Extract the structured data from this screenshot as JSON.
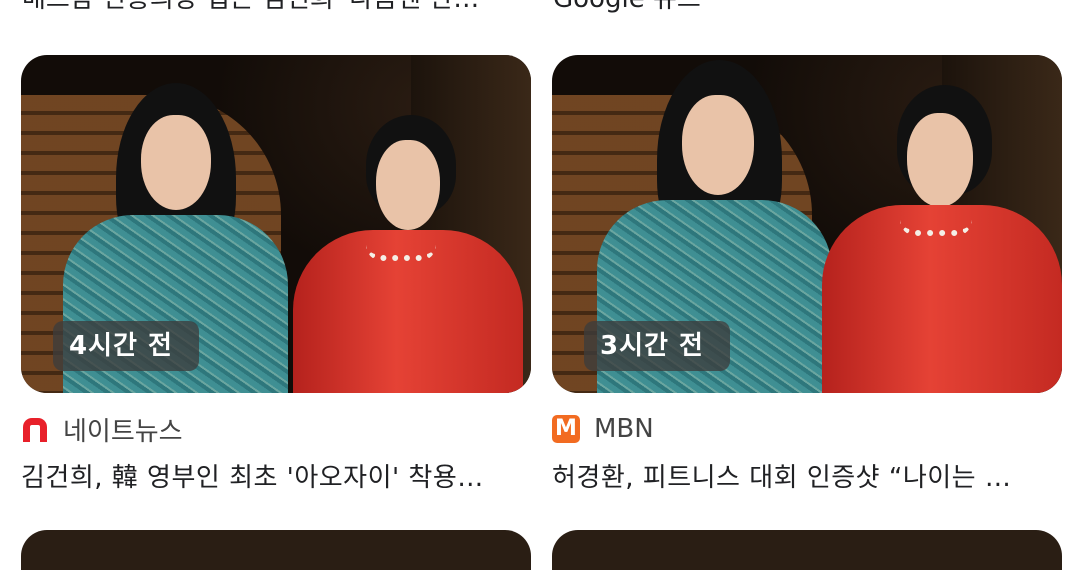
{
  "top_row": {
    "left_text": "배드람 전통의상 입은 김건희 '다음엔 한…",
    "right_text": "Google 뉴스"
  },
  "cards": [
    {
      "time": "4시간 전",
      "source": "네이트뉴스",
      "source_icon": "nate-logo-icon",
      "headline": "김건희, 韓 영부인 최초 '아오자이' 착용…"
    },
    {
      "time": "3시간 전",
      "source": "MBN",
      "source_icon": "mbn-logo-icon",
      "headline": "허경환, 피트니스 대회 인증샷 “나이는 …"
    }
  ],
  "colors": {
    "nate_red": "#e8202a",
    "mbn_orange": "#f26b21"
  }
}
